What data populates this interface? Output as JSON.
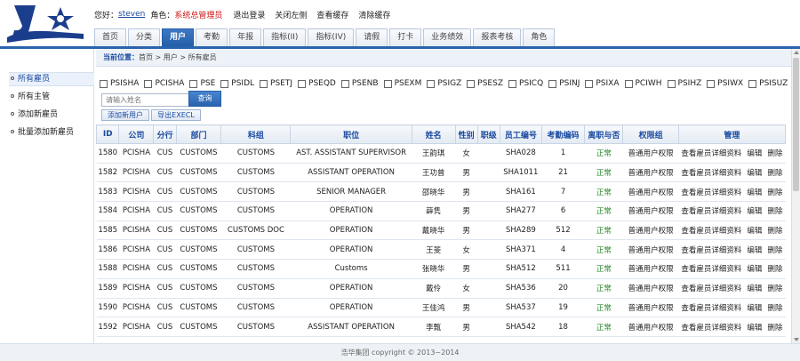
{
  "header": {
    "greeting": "您好：",
    "username": "steven",
    "role_label": "角色：",
    "role_value": "系统总管理员",
    "links": [
      "退出登录",
      "关闭左侧",
      "查看缓存",
      "清除缓存"
    ]
  },
  "tabs": [
    {
      "label": "首页",
      "active": false
    },
    {
      "label": "分类",
      "active": false
    },
    {
      "label": "用户",
      "active": true
    },
    {
      "label": "考勤",
      "active": false
    },
    {
      "label": "年报",
      "active": false
    },
    {
      "label": "指标(II)",
      "active": false
    },
    {
      "label": "指标(IV)",
      "active": false
    },
    {
      "label": "请假",
      "active": false
    },
    {
      "label": "打卡",
      "active": false
    },
    {
      "label": "业务绩效",
      "active": false
    },
    {
      "label": "报表考核",
      "active": false
    },
    {
      "label": "角色",
      "active": false
    }
  ],
  "sidebar": {
    "items": [
      {
        "label": "所有雇员",
        "active": true
      },
      {
        "label": "所有主管",
        "active": false
      },
      {
        "label": "添加新雇员",
        "active": false
      },
      {
        "label": "批量添加新雇员",
        "active": false
      }
    ]
  },
  "breadcrumb": {
    "label": "当前位置：",
    "path": "首页 > 用户 > 所有雇员"
  },
  "filters": [
    "PSISHA",
    "PCISHA",
    "PSE",
    "PSIDL",
    "PSETJ",
    "PSEQD",
    "PSENB",
    "PSEXM",
    "PSIGZ",
    "PSESZ",
    "PSICQ",
    "PSINJ",
    "PSIXA",
    "PCIWH",
    "PSIHZ",
    "PSIWX",
    "PSISUZ"
  ],
  "search": {
    "placeholder": "请输入姓名",
    "button_label": "查询"
  },
  "actions": {
    "add_label": "添加新用户",
    "export_label": "导出EXECL"
  },
  "table": {
    "columns": [
      "ID",
      "公司",
      "分行",
      "部门",
      "科组",
      "职位",
      "姓名",
      "性别",
      "职级",
      "员工编号",
      "考勤编码",
      "离职与否",
      "权限组",
      "管理"
    ],
    "ops": [
      "查看雇员详细资料",
      "编辑",
      "删除"
    ],
    "rows": [
      [
        "1580",
        "PCISHA",
        "CUS",
        "CUSTOMS",
        "CUSTOMS",
        "AST. ASSISTANT SUPERVISOR",
        "王韵琪",
        "女",
        "",
        "SHA028",
        "1",
        "正常",
        "普通用户权限"
      ],
      [
        "1582",
        "PCISHA",
        "CUS",
        "CUSTOMS",
        "CUSTOMS",
        "ASSISTANT OPERATION",
        "王功曾",
        "男",
        "",
        "SHA1011",
        "21",
        "正常",
        "普通用户权限"
      ],
      [
        "1583",
        "PCISHA",
        "CUS",
        "CUSTOMS",
        "CUSTOMS",
        "SENIOR MANAGER",
        "邵晓华",
        "男",
        "",
        "SHA161",
        "7",
        "正常",
        "普通用户权限"
      ],
      [
        "1584",
        "PCISHA",
        "CUS",
        "CUSTOMS",
        "CUSTOMS",
        "OPERATION",
        "薛隽",
        "男",
        "",
        "SHA277",
        "6",
        "正常",
        "普通用户权限"
      ],
      [
        "1585",
        "PCISHA",
        "CUS",
        "CUSTOMS",
        "CUSTOMS DOC",
        "OPERATION",
        "戴晓华",
        "男",
        "",
        "SHA289",
        "512",
        "正常",
        "普通用户权限"
      ],
      [
        "1586",
        "PCISHA",
        "CUS",
        "CUSTOMS",
        "CUSTOMS",
        "OPERATION",
        "王斐",
        "女",
        "",
        "SHA371",
        "4",
        "正常",
        "普通用户权限"
      ],
      [
        "1588",
        "PCISHA",
        "CUS",
        "CUSTOMS",
        "CUSTOMS",
        "Customs",
        "张晓华",
        "男",
        "",
        "SHA512",
        "511",
        "正常",
        "普通用户权限"
      ],
      [
        "1589",
        "PCISHA",
        "CUS",
        "CUSTOMS",
        "CUSTOMS",
        "OPERATION",
        "戴伶",
        "女",
        "",
        "SHA536",
        "20",
        "正常",
        "普通用户权限"
      ],
      [
        "1590",
        "PCISHA",
        "CUS",
        "CUSTOMS",
        "CUSTOMS",
        "OPERATION",
        "王佳鸿",
        "男",
        "",
        "SHA537",
        "19",
        "正常",
        "普通用户权限"
      ],
      [
        "1592",
        "PCISHA",
        "CUS",
        "CUSTOMS",
        "CUSTOMS",
        "ASSISTANT OPERATION",
        "李甄",
        "男",
        "",
        "SHA542",
        "18",
        "正常",
        "普通用户权限"
      ]
    ]
  },
  "footer": "浩华集团 copyright © 2013~2014",
  "colors": {
    "accent": "#2a63ad",
    "status_normal": "#2a8a2a",
    "role": "#d01010"
  }
}
